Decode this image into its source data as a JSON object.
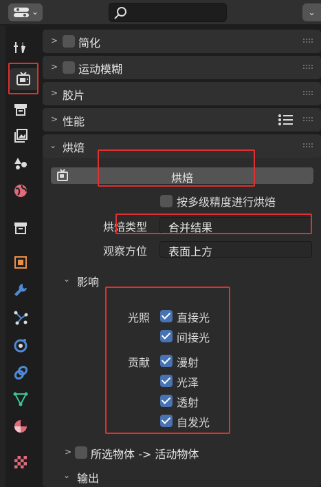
{
  "header": {
    "editor_icon": "properties-editor-icon",
    "search_placeholder": "",
    "dropdown_icon": "chevron-down-icon"
  },
  "tabs": [
    {
      "name": "tool-tab",
      "icon": "tool-icon",
      "active": false
    },
    {
      "name": "render-tab",
      "icon": "render-icon",
      "active": true
    },
    {
      "name": "output-tab",
      "icon": "output-icon",
      "active": false
    },
    {
      "name": "view-layer-tab",
      "icon": "view-layer-icon",
      "active": false
    },
    {
      "name": "scene-tab",
      "icon": "scene-icon",
      "active": false
    },
    {
      "name": "world-tab",
      "icon": "world-icon",
      "active": false
    },
    {
      "name": "collection-tab",
      "icon": "collection-icon",
      "active": false
    },
    {
      "name": "object-tab",
      "icon": "object-icon",
      "active": false
    },
    {
      "name": "modifier-tab",
      "icon": "wrench-icon",
      "active": false
    },
    {
      "name": "particles-tab",
      "icon": "particles-icon",
      "active": false
    },
    {
      "name": "physics-tab",
      "icon": "physics-icon",
      "active": false
    },
    {
      "name": "constraints-tab",
      "icon": "constraints-icon",
      "active": false
    },
    {
      "name": "data-tab",
      "icon": "mesh-data-icon",
      "active": false
    },
    {
      "name": "material-tab",
      "icon": "material-icon",
      "active": false
    },
    {
      "name": "texture-tab",
      "icon": "texture-icon",
      "active": false
    }
  ],
  "panels": {
    "simplify": {
      "title": "简化",
      "enabled": false
    },
    "motion_blur": {
      "title": "运动模糊",
      "enabled": false
    },
    "film": {
      "title": "胶片"
    },
    "performance": {
      "title": "性能"
    },
    "bake": {
      "title": "烘焙",
      "bake_button": "烘焙",
      "multires_label": "按多级精度进行烘焙",
      "multires_enabled": false,
      "bake_type_label": "烘焙类型",
      "bake_type_value": "合并结果",
      "view_from_label": "观察方位",
      "view_from_value": "表面上方",
      "influence": {
        "title": "影响",
        "lighting_label": "光照",
        "direct_label": "直接光",
        "direct_enabled": true,
        "indirect_label": "间接光",
        "indirect_enabled": true,
        "contributions_label": "贡献",
        "diffuse_label": "漫射",
        "diffuse_enabled": true,
        "glossy_label": "光泽",
        "glossy_enabled": true,
        "transmission_label": "透射",
        "transmission_enabled": true,
        "emission_label": "自发光",
        "emission_enabled": true
      },
      "selected_to_active": {
        "title": "所选物体 -> 活动物体",
        "enabled": false
      },
      "output": {
        "title": "输出"
      }
    }
  },
  "colors": {
    "accent": "#4772b3",
    "highlight": "#e03030",
    "background": "#1d1d1d",
    "panel": "#2b2b2b"
  }
}
